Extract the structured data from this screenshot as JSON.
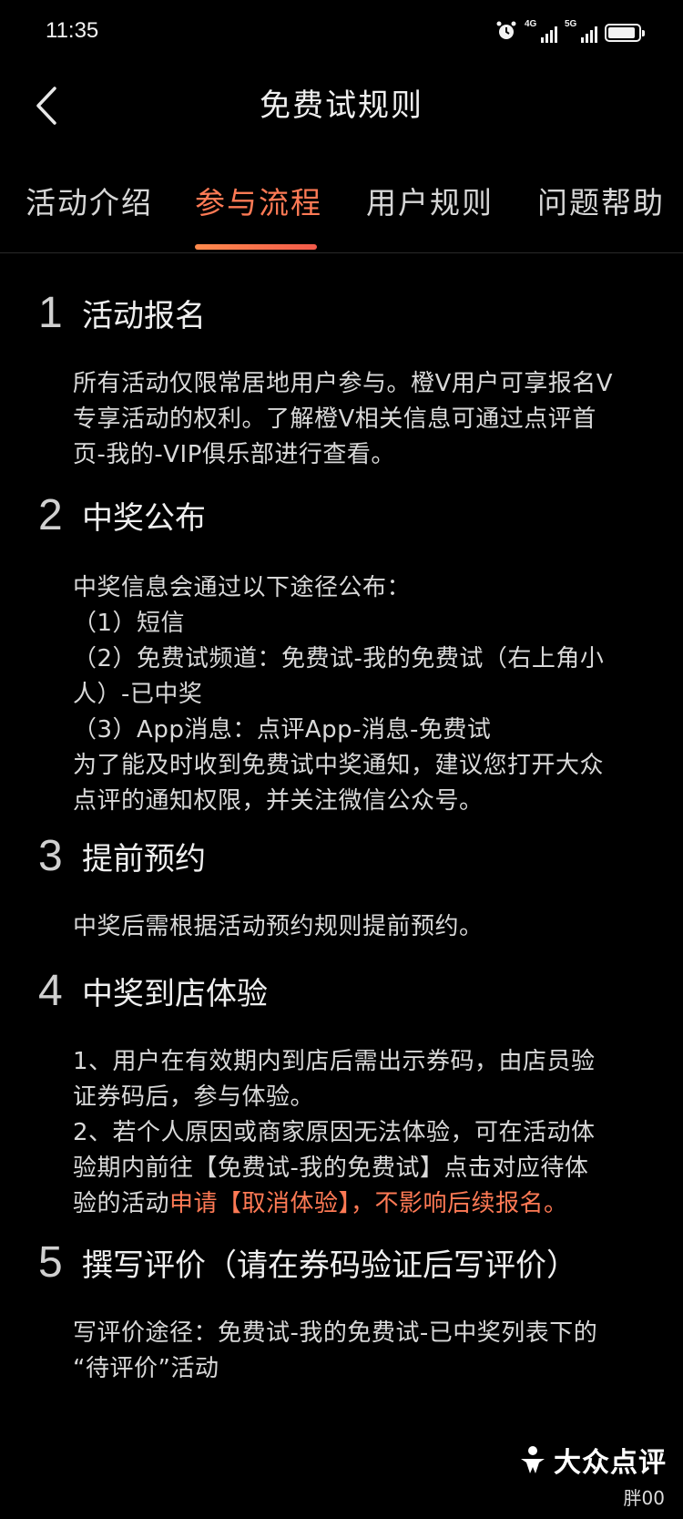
{
  "status": {
    "time": "11:35",
    "net1": "4G",
    "net2": "5G"
  },
  "nav": {
    "title": "免费试规则"
  },
  "tabs": [
    {
      "label": "活动介绍"
    },
    {
      "label": "参与流程"
    },
    {
      "label": "用户规则"
    },
    {
      "label": "问题帮助"
    }
  ],
  "sections": [
    {
      "num": "1",
      "title": "活动报名",
      "lines": [
        "所有活动仅限常居地用户参与。橙V用户可享报名V",
        "专享活动的权利。了解橙V相关信息可通过点评首",
        "页-我的-VIP俱乐部进行查看。"
      ]
    },
    {
      "num": "2",
      "title": "中奖公布",
      "lines": [
        "中奖信息会通过以下途径公布：",
        "（1）短信",
        "（2）免费试频道：免费试-我的免费试（右上角小",
        "人）-已中奖",
        "（3）App消息：点评App-消息-免费试",
        "为了能及时收到免费试中奖通知，建议您打开大众",
        "点评的通知权限，并关注微信公众号。"
      ]
    },
    {
      "num": "3",
      "title": "提前预约",
      "lines": [
        "中奖后需根据活动预约规则提前预约。"
      ]
    },
    {
      "num": "4",
      "title": "中奖到店体验",
      "lines": [
        "1、用户在有效期内到店后需出示券码，由店员验",
        "证券码后，参与体验。",
        "2、若个人原因或商家原因无法体验，可在活动体",
        "验期内前往【免费试-我的免费试】点击对应待体"
      ],
      "last_line_plain": "验的活动",
      "last_line_highlight": "申请【取消体验】，不影响后续报名。"
    },
    {
      "num": "5",
      "title": "撰写评价（请在券码验证后写评价）",
      "lines": [
        "写评价途径：免费试-我的免费试-已中奖列表下的",
        "“待评价”活动"
      ]
    }
  ],
  "watermark": {
    "brand": "大众点评",
    "user": "胖00"
  },
  "colors": {
    "accent": "#ff7a55",
    "background": "#000000"
  }
}
